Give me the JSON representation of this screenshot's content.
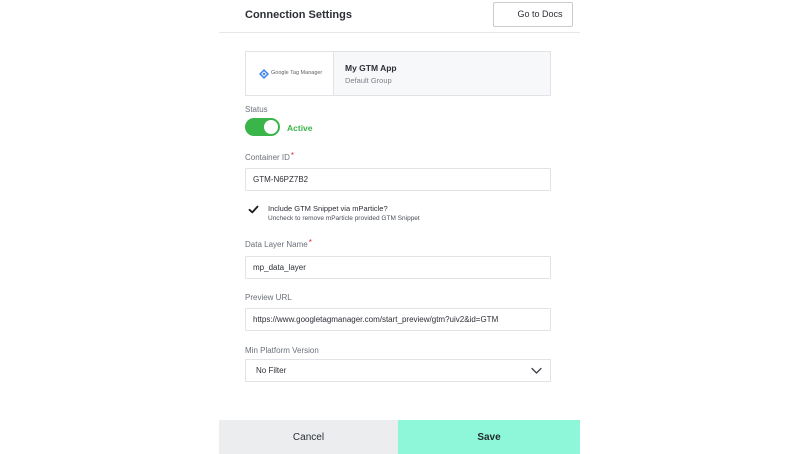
{
  "header": {
    "title": "Connection Settings",
    "docs_button": "Go to Docs"
  },
  "app": {
    "logo_text": "Google Tag Manager",
    "logo_icon": "google-tag-manager-icon",
    "name": "My GTM App",
    "group": "Default Group"
  },
  "status": {
    "label": "Status",
    "value": "Active",
    "enabled": true,
    "color": "#3ab54a"
  },
  "container_id": {
    "label": "Container ID",
    "required_mark": "*",
    "value": "GTM-N6PZ7B2"
  },
  "snippet": {
    "checked": true,
    "label": "Include GTM Snippet via mParticle?",
    "help": "Uncheck to remove mParticle provided GTM Snippet"
  },
  "data_layer": {
    "label": "Data Layer Name",
    "required_mark": "*",
    "value": "mp_data_layer"
  },
  "preview_url": {
    "label": "Preview URL",
    "value": "https://www.googletagmanager.com/start_preview/gtm?uiv2&id=GTM"
  },
  "min_platform": {
    "label": "Min Platform Version",
    "value": "No Filter"
  },
  "footer": {
    "cancel": "Cancel",
    "save": "Save",
    "save_color": "#8ef7d9"
  }
}
